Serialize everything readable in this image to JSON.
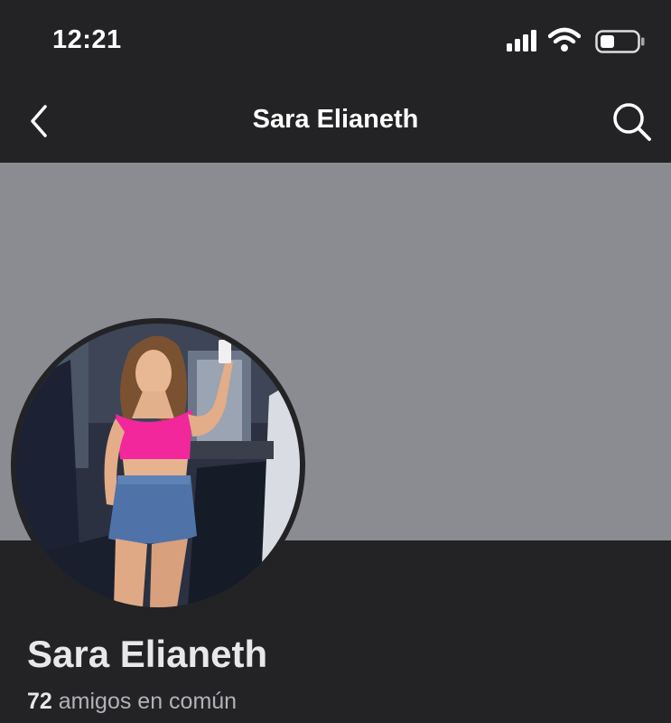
{
  "status_bar": {
    "time": "12:21",
    "signal_icon": "cellular-signal-icon",
    "wifi_icon": "wifi-icon",
    "battery_icon": "battery-icon"
  },
  "nav": {
    "title": "Sara Elianeth",
    "back_icon": "chevron-left-icon",
    "search_icon": "search-icon"
  },
  "profile": {
    "name": "Sara Elianeth",
    "mutual_friends_count": "72",
    "mutual_friends_text": " amigos en común"
  },
  "colors": {
    "background": "#232325",
    "cover": "#8a8c91",
    "text_primary": "#ffffff",
    "text_secondary": "#b0b3b8"
  }
}
